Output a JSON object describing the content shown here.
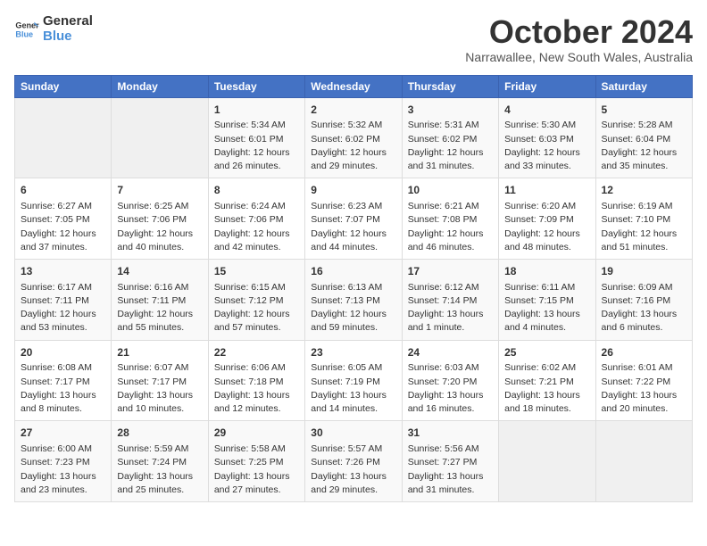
{
  "header": {
    "logo_line1": "General",
    "logo_line2": "Blue",
    "month": "October 2024",
    "location": "Narrawallee, New South Wales, Australia"
  },
  "weekdays": [
    "Sunday",
    "Monday",
    "Tuesday",
    "Wednesday",
    "Thursday",
    "Friday",
    "Saturday"
  ],
  "weeks": [
    [
      {
        "day": "",
        "info": ""
      },
      {
        "day": "",
        "info": ""
      },
      {
        "day": "1",
        "info": "Sunrise: 5:34 AM\nSunset: 6:01 PM\nDaylight: 12 hours\nand 26 minutes."
      },
      {
        "day": "2",
        "info": "Sunrise: 5:32 AM\nSunset: 6:02 PM\nDaylight: 12 hours\nand 29 minutes."
      },
      {
        "day": "3",
        "info": "Sunrise: 5:31 AM\nSunset: 6:02 PM\nDaylight: 12 hours\nand 31 minutes."
      },
      {
        "day": "4",
        "info": "Sunrise: 5:30 AM\nSunset: 6:03 PM\nDaylight: 12 hours\nand 33 minutes."
      },
      {
        "day": "5",
        "info": "Sunrise: 5:28 AM\nSunset: 6:04 PM\nDaylight: 12 hours\nand 35 minutes."
      }
    ],
    [
      {
        "day": "6",
        "info": "Sunrise: 6:27 AM\nSunset: 7:05 PM\nDaylight: 12 hours\nand 37 minutes."
      },
      {
        "day": "7",
        "info": "Sunrise: 6:25 AM\nSunset: 7:06 PM\nDaylight: 12 hours\nand 40 minutes."
      },
      {
        "day": "8",
        "info": "Sunrise: 6:24 AM\nSunset: 7:06 PM\nDaylight: 12 hours\nand 42 minutes."
      },
      {
        "day": "9",
        "info": "Sunrise: 6:23 AM\nSunset: 7:07 PM\nDaylight: 12 hours\nand 44 minutes."
      },
      {
        "day": "10",
        "info": "Sunrise: 6:21 AM\nSunset: 7:08 PM\nDaylight: 12 hours\nand 46 minutes."
      },
      {
        "day": "11",
        "info": "Sunrise: 6:20 AM\nSunset: 7:09 PM\nDaylight: 12 hours\nand 48 minutes."
      },
      {
        "day": "12",
        "info": "Sunrise: 6:19 AM\nSunset: 7:10 PM\nDaylight: 12 hours\nand 51 minutes."
      }
    ],
    [
      {
        "day": "13",
        "info": "Sunrise: 6:17 AM\nSunset: 7:11 PM\nDaylight: 12 hours\nand 53 minutes."
      },
      {
        "day": "14",
        "info": "Sunrise: 6:16 AM\nSunset: 7:11 PM\nDaylight: 12 hours\nand 55 minutes."
      },
      {
        "day": "15",
        "info": "Sunrise: 6:15 AM\nSunset: 7:12 PM\nDaylight: 12 hours\nand 57 minutes."
      },
      {
        "day": "16",
        "info": "Sunrise: 6:13 AM\nSunset: 7:13 PM\nDaylight: 12 hours\nand 59 minutes."
      },
      {
        "day": "17",
        "info": "Sunrise: 6:12 AM\nSunset: 7:14 PM\nDaylight: 13 hours\nand 1 minute."
      },
      {
        "day": "18",
        "info": "Sunrise: 6:11 AM\nSunset: 7:15 PM\nDaylight: 13 hours\nand 4 minutes."
      },
      {
        "day": "19",
        "info": "Sunrise: 6:09 AM\nSunset: 7:16 PM\nDaylight: 13 hours\nand 6 minutes."
      }
    ],
    [
      {
        "day": "20",
        "info": "Sunrise: 6:08 AM\nSunset: 7:17 PM\nDaylight: 13 hours\nand 8 minutes."
      },
      {
        "day": "21",
        "info": "Sunrise: 6:07 AM\nSunset: 7:17 PM\nDaylight: 13 hours\nand 10 minutes."
      },
      {
        "day": "22",
        "info": "Sunrise: 6:06 AM\nSunset: 7:18 PM\nDaylight: 13 hours\nand 12 minutes."
      },
      {
        "day": "23",
        "info": "Sunrise: 6:05 AM\nSunset: 7:19 PM\nDaylight: 13 hours\nand 14 minutes."
      },
      {
        "day": "24",
        "info": "Sunrise: 6:03 AM\nSunset: 7:20 PM\nDaylight: 13 hours\nand 16 minutes."
      },
      {
        "day": "25",
        "info": "Sunrise: 6:02 AM\nSunset: 7:21 PM\nDaylight: 13 hours\nand 18 minutes."
      },
      {
        "day": "26",
        "info": "Sunrise: 6:01 AM\nSunset: 7:22 PM\nDaylight: 13 hours\nand 20 minutes."
      }
    ],
    [
      {
        "day": "27",
        "info": "Sunrise: 6:00 AM\nSunset: 7:23 PM\nDaylight: 13 hours\nand 23 minutes."
      },
      {
        "day": "28",
        "info": "Sunrise: 5:59 AM\nSunset: 7:24 PM\nDaylight: 13 hours\nand 25 minutes."
      },
      {
        "day": "29",
        "info": "Sunrise: 5:58 AM\nSunset: 7:25 PM\nDaylight: 13 hours\nand 27 minutes."
      },
      {
        "day": "30",
        "info": "Sunrise: 5:57 AM\nSunset: 7:26 PM\nDaylight: 13 hours\nand 29 minutes."
      },
      {
        "day": "31",
        "info": "Sunrise: 5:56 AM\nSunset: 7:27 PM\nDaylight: 13 hours\nand 31 minutes."
      },
      {
        "day": "",
        "info": ""
      },
      {
        "day": "",
        "info": ""
      }
    ]
  ]
}
